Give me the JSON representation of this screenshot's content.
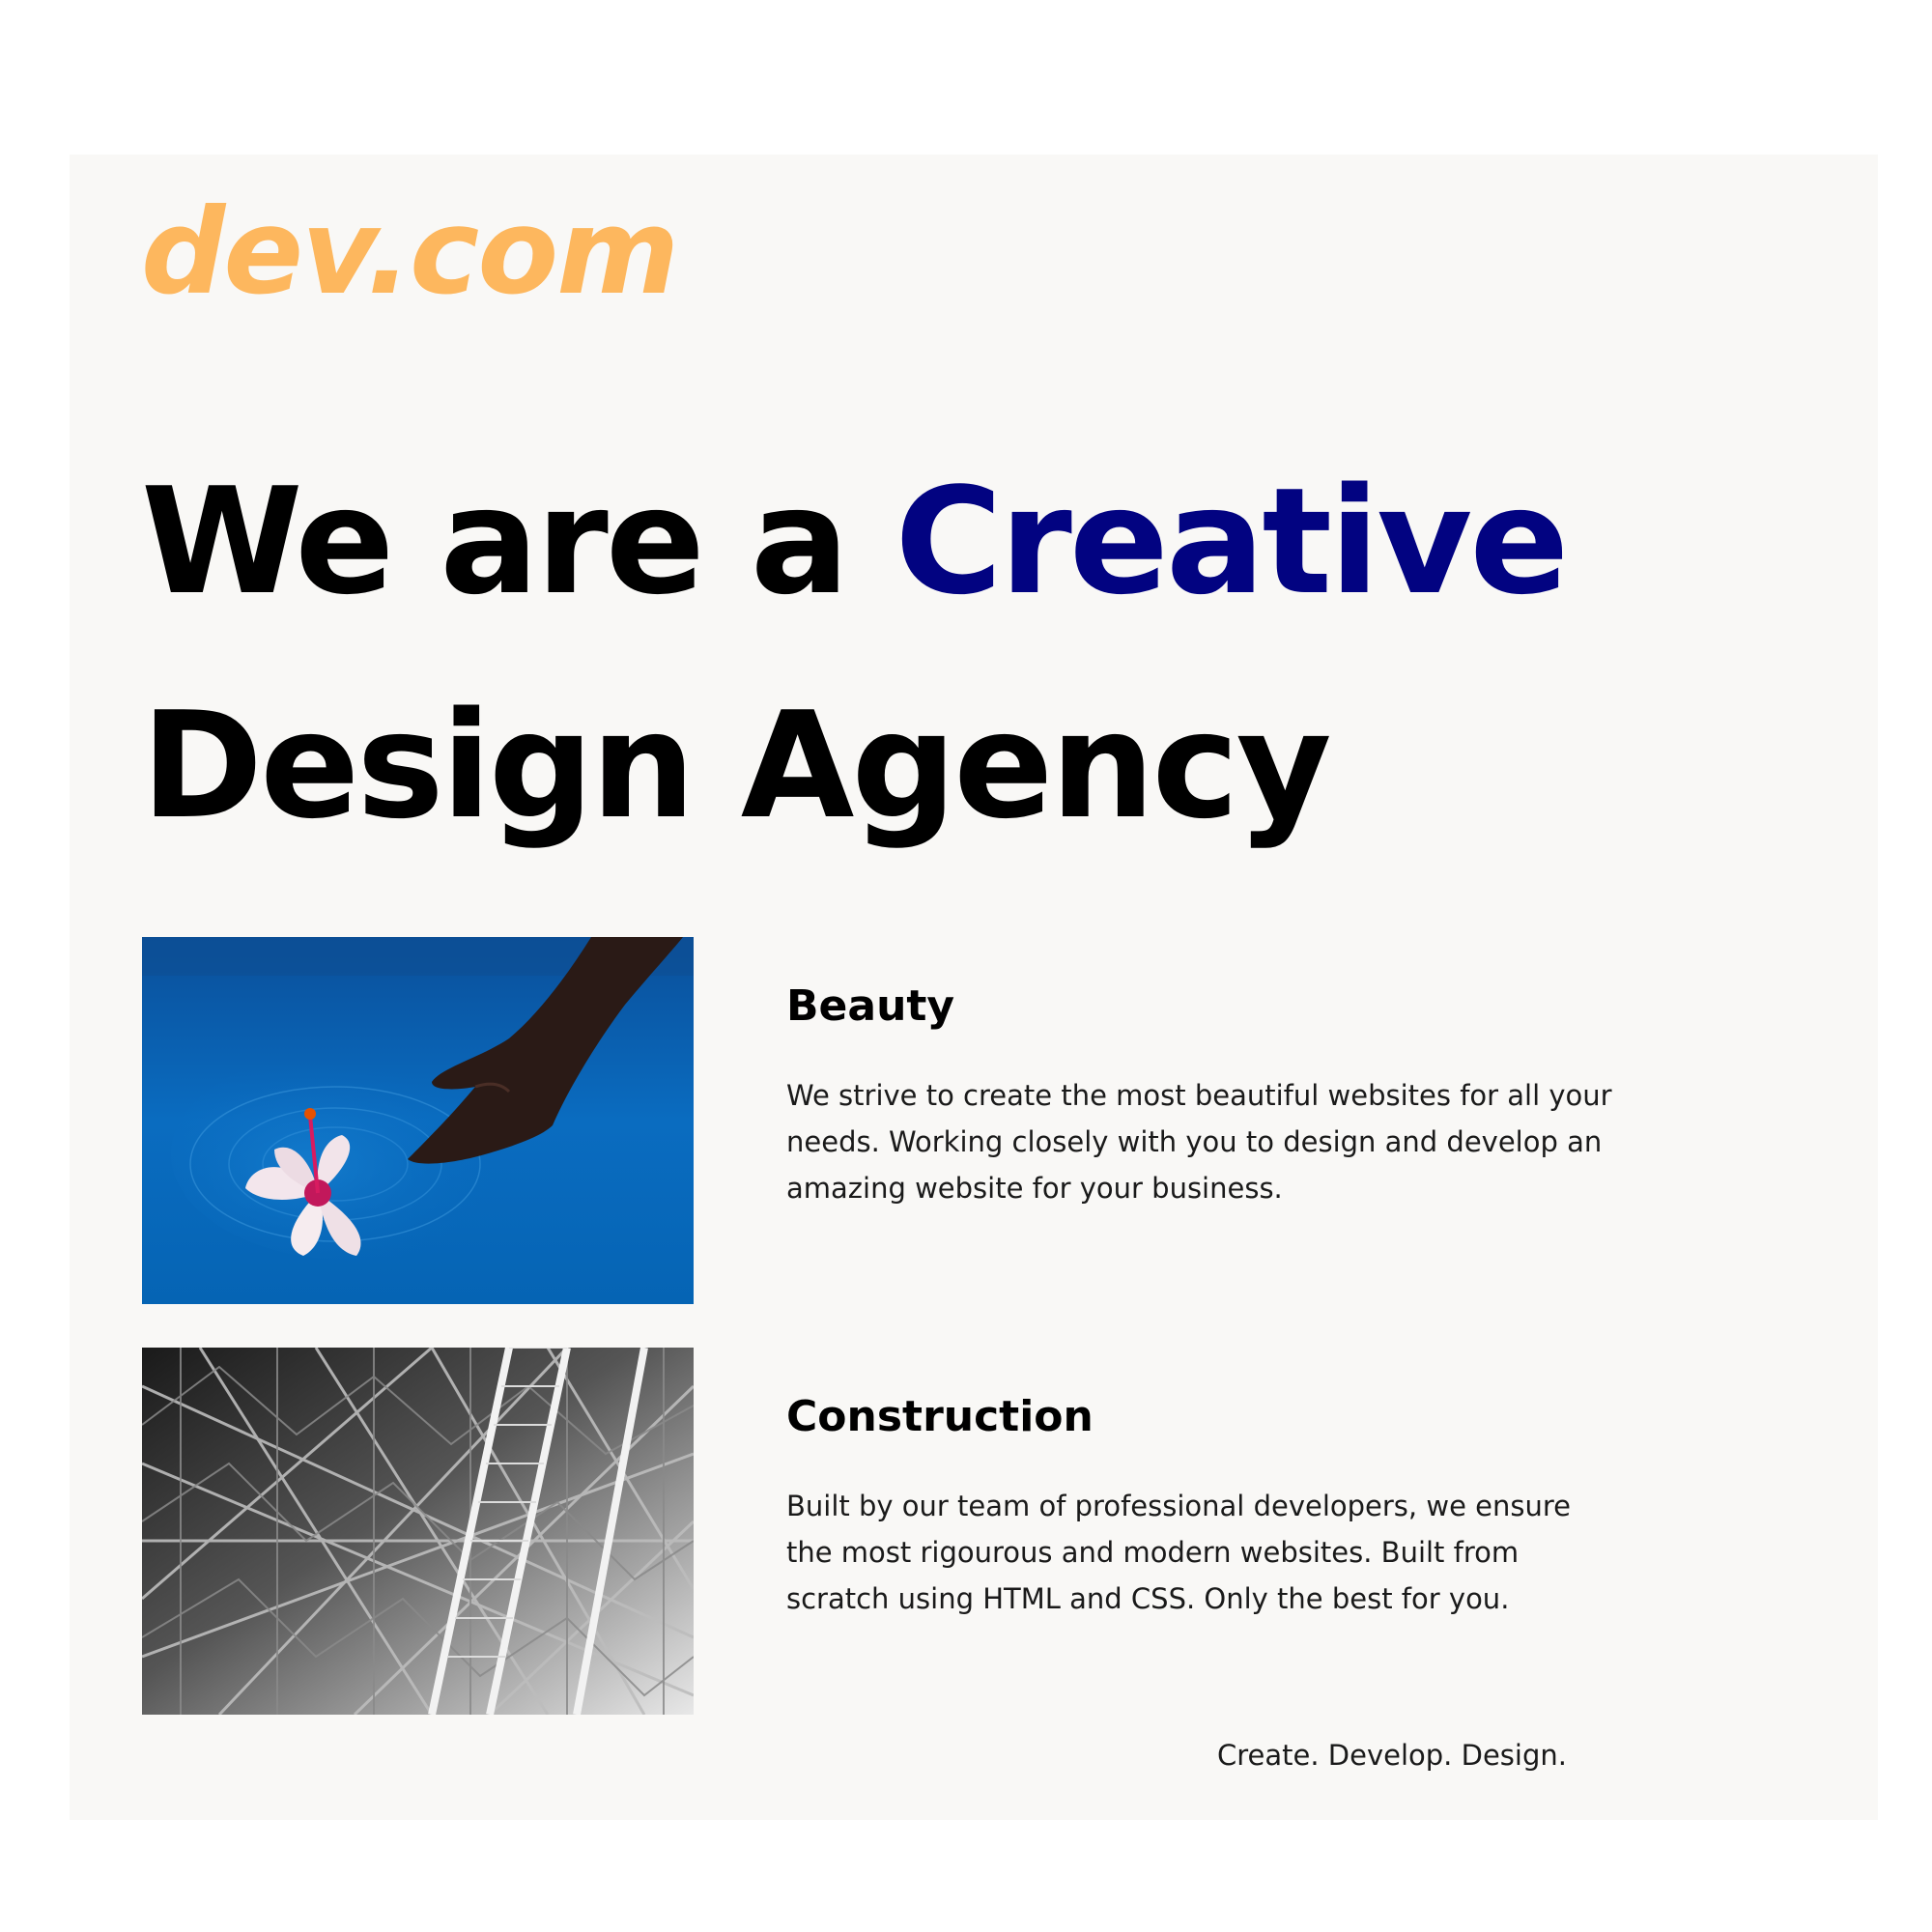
{
  "brand": {
    "logo_text": "dev.com",
    "logo_color": "#fdb75e",
    "accent_color": "#020381"
  },
  "hero": {
    "line1_prefix": "We are a ",
    "line1_accent": "Creative",
    "line2": "Design Agency"
  },
  "features": [
    {
      "title": "Beauty",
      "text": "We strive to create the most beautiful websites for all your needs. Working closely with you to design and develop an amazing website for your business.",
      "image_icon": "flower-on-water-photo"
    },
    {
      "title": "Construction",
      "text": "Built by our team of professional developers, we ensure the most rigourous and modern websites. Built from scratch using HTML and CSS. Only the best for you.",
      "image_icon": "steel-structure-photo"
    }
  ],
  "footer": {
    "tagline": "Create. Develop. Design."
  }
}
